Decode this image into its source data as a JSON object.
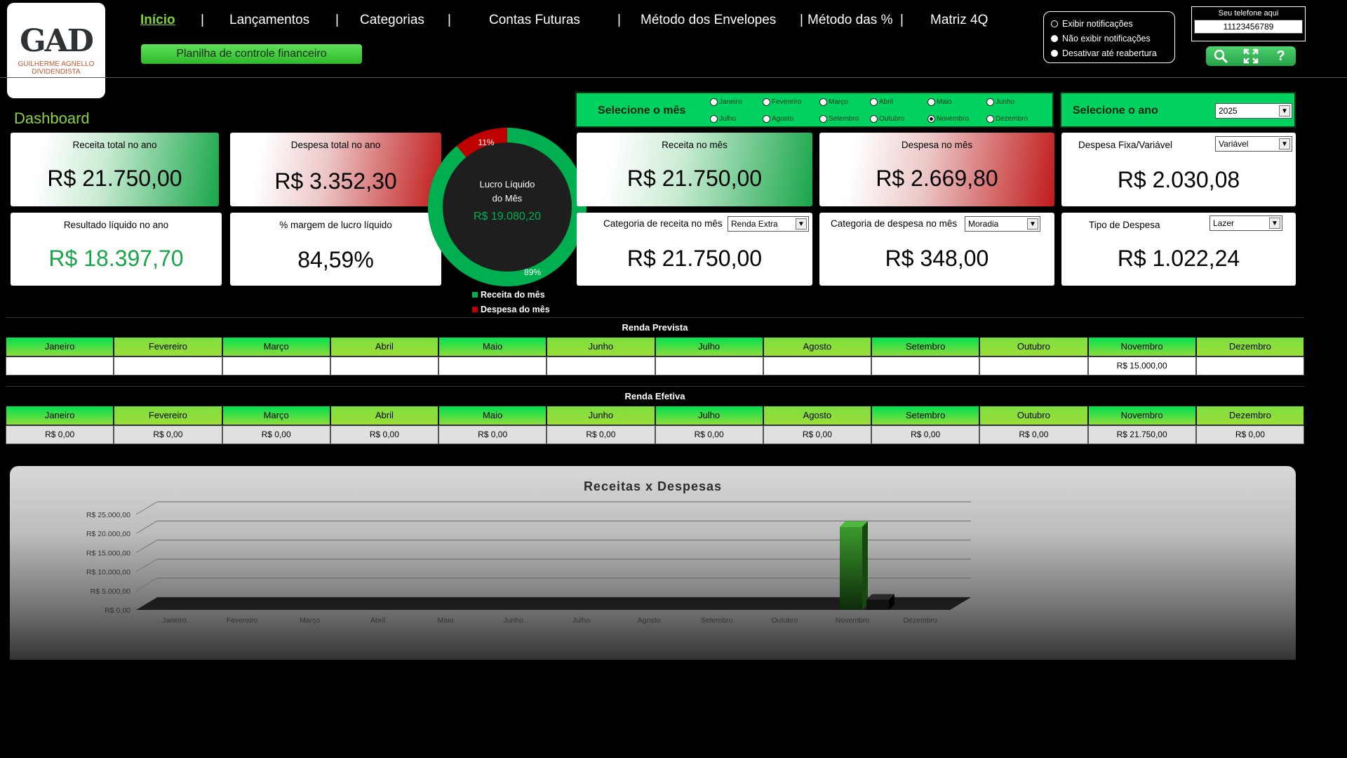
{
  "logo": {
    "mark": "GAD",
    "name_line1": "GUILHERME AGNELLO",
    "name_line2": "DIVIDENDISTA"
  },
  "nav": {
    "items": [
      "Início",
      "Lançamentos",
      "Categorias",
      "Contas Futuras",
      "Método dos Envelopes",
      "Método das %",
      "Matriz 4Q"
    ],
    "sub_button": "Planilha de controle financeiro"
  },
  "notifications": {
    "options": [
      "Exibir notificações",
      "Não exibir notificações",
      "Desativar até reabertura"
    ]
  },
  "phone": {
    "label": "Seu telefone aqui",
    "value": "11123456789"
  },
  "tools": [
    "search-icon",
    "fullscreen-icon",
    "help-icon"
  ],
  "dashboard_title": "Dashboard",
  "kpi": {
    "receita_ano": {
      "label": "Receita total no ano",
      "value": "R$ 21.750,00"
    },
    "despesa_ano": {
      "label": "Despesa total no ano",
      "value": "R$ 3.352,30"
    },
    "resultado_ano": {
      "label": "Resultado líquido no ano",
      "value": "R$ 18.397,70"
    },
    "margem": {
      "label": "% margem de lucro líquido",
      "value": "84,59%"
    },
    "receita_mes": {
      "label": "Receita no mês",
      "value": "R$ 21.750,00"
    },
    "despesa_mes": {
      "label": "Despesa no mês",
      "value": "R$ 2.669,80"
    },
    "despesa_fixa": {
      "label": "Despesa Fixa/Variável",
      "value": "R$ 2.030,08",
      "selected": "Variável"
    },
    "cat_receita": {
      "label": "Categoria de receita no mês",
      "value": "R$ 21.750,00",
      "selected": "Renda Extra"
    },
    "cat_despesa": {
      "label": "Categoria de despesa no mês",
      "value": "R$ 348,00",
      "selected": "Moradia"
    },
    "tipo_despesa": {
      "label": "Tipo de Despesa",
      "value": "R$ 1.022,24",
      "selected": "Lazer"
    }
  },
  "month_selector": {
    "title": "Selecione o mês",
    "months": [
      "Janeiro",
      "Fevereiro",
      "Março",
      "Abril",
      "Maio",
      "Junho",
      "Julho",
      "Agosto",
      "Setembro",
      "Outubro",
      "Novembro",
      "Dezembro"
    ],
    "selected": "Novembro"
  },
  "year_selector": {
    "title": "Selecione o ano",
    "selected": "2025"
  },
  "donut": {
    "center_line1": "Lucro Líquido",
    "center_line2": "do Mês",
    "center_value": "R$ 19.080,20",
    "receita_pct": 89,
    "despesa_pct": 11,
    "receita_label": "89%",
    "despesa_label": "11%",
    "legend": [
      "Receita do mês",
      "Despesa do mês"
    ],
    "colors": {
      "receita": "#00b050",
      "despesa": "#c00000"
    }
  },
  "renda_prevista": {
    "title": "Renda Prevista",
    "months": [
      "Janeiro",
      "Fevereiro",
      "Março",
      "Abril",
      "Maio",
      "Junho",
      "Julho",
      "Agosto",
      "Setembro",
      "Outubro",
      "Novembro",
      "Dezembro"
    ],
    "values": [
      "",
      "",
      "",
      "",
      "",
      "",
      "",
      "",
      "",
      "",
      "R$ 15.000,00",
      ""
    ]
  },
  "renda_efetiva": {
    "title": "Renda Efetiva",
    "months": [
      "Janeiro",
      "Fevereiro",
      "Março",
      "Abril",
      "Maio",
      "Junho",
      "Julho",
      "Agosto",
      "Setembro",
      "Outubro",
      "Novembro",
      "Dezembro"
    ],
    "values": [
      "R$ 0,00",
      "R$ 0,00",
      "R$ 0,00",
      "R$ 0,00",
      "R$ 0,00",
      "R$ 0,00",
      "R$ 0,00",
      "R$ 0,00",
      "R$ 0,00",
      "R$ 0,00",
      "R$ 21.750,00",
      "R$ 0,00"
    ]
  },
  "chart_data": {
    "type": "bar",
    "title": "Receitas x Despesas",
    "categories": [
      "Janeiro",
      "Fevereiro",
      "Março",
      "Abril",
      "Maio",
      "Junho",
      "Julho",
      "Agosto",
      "Setembro",
      "Outubro",
      "Novembro",
      "Dezembro"
    ],
    "series": [
      {
        "values": [
          0,
          0,
          0,
          0,
          0,
          0,
          0,
          0,
          0,
          0,
          21750,
          0
        ],
        "color": "#2f8a26"
      },
      {
        "values": [
          0,
          0,
          0,
          0,
          0,
          0,
          0,
          0,
          0,
          0,
          2669.8,
          0
        ],
        "color": "#1a1a1a"
      }
    ],
    "yticks": [
      "R$ 0,00",
      "R$ 5.000,00",
      "R$ 10.000,00",
      "R$ 15.000,00",
      "R$ 20.000,00",
      "R$ 25.000,00"
    ],
    "ylim": [
      0,
      25000
    ],
    "grid": true
  }
}
